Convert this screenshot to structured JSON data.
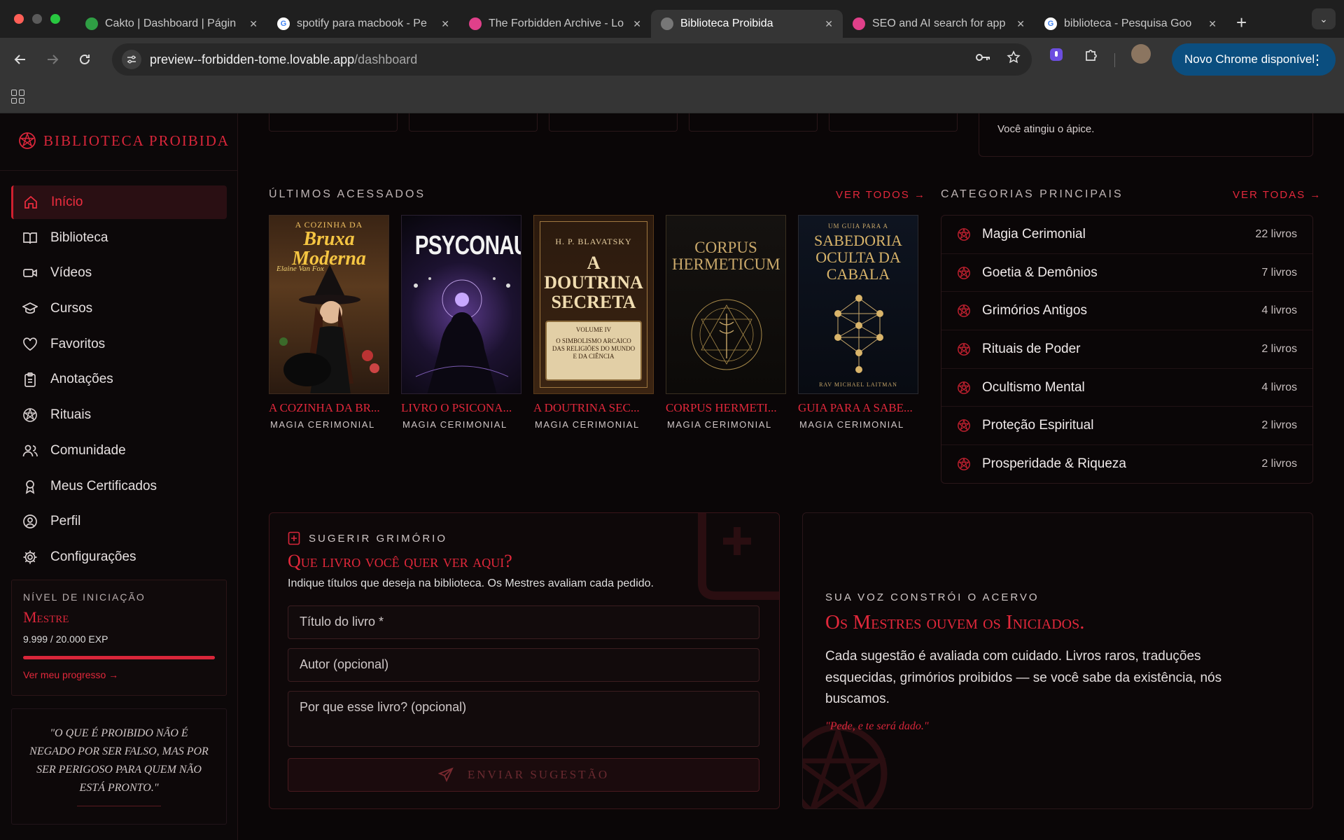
{
  "browser": {
    "tabs": [
      {
        "title": "Cakto | Dashboard | Págin",
        "icon": "cakto-icon",
        "color": "#2f9e44"
      },
      {
        "title": "spotify para macbook - Pe",
        "icon": "google-icon",
        "color": "#ffffff"
      },
      {
        "title": "The Forbidden Archive - Lo",
        "icon": "lovable-icon",
        "color": "#e0408a"
      },
      {
        "title": "Biblioteca Proibida",
        "icon": "globe-icon",
        "color": "#9a9a9a"
      },
      {
        "title": "SEO and AI search for app",
        "icon": "lovable-icon",
        "color": "#e0408a"
      },
      {
        "title": "biblioteca - Pesquisa Goo",
        "icon": "google-icon",
        "color": "#ffffff"
      }
    ],
    "active_tab": 3,
    "url_host": "preview--forbidden-tome.lovable.app",
    "url_path": "/dashboard",
    "update_button": "Novo Chrome disponível"
  },
  "sidebar": {
    "brand": "BIBLIOTECA PROIBIDA",
    "items": [
      {
        "label": "Início",
        "icon": "home-icon",
        "active": true
      },
      {
        "label": "Biblioteca",
        "icon": "book-open-icon"
      },
      {
        "label": "Vídeos",
        "icon": "video-icon"
      },
      {
        "label": "Cursos",
        "icon": "graduation-cap-icon"
      },
      {
        "label": "Favoritos",
        "icon": "heart-icon"
      },
      {
        "label": "Anotações",
        "icon": "clipboard-icon"
      },
      {
        "label": "Rituais",
        "icon": "pentagram-icon"
      },
      {
        "label": "Comunidade",
        "icon": "users-icon"
      },
      {
        "label": "Meus Certificados",
        "icon": "award-icon"
      },
      {
        "label": "Perfil",
        "icon": "user-circle-icon"
      },
      {
        "label": "Configurações",
        "icon": "gear-icon"
      }
    ],
    "level": {
      "label": "NÍVEL DE INICIAÇÃO",
      "name": "Mestre",
      "exp": "9.999 / 20.000 EXP",
      "progress": 0.99995,
      "link": "Ver meu progresso →"
    },
    "quote": "\"O que é proibido não é negado por ser falso, mas por ser perigoso para quem não está pronto.\""
  },
  "main": {
    "top_card_text": "Você atingiu o ápice.",
    "recent": {
      "title": "ÚLTIMOS ACESSADOS",
      "see_all": "VER TODOS →",
      "books": [
        {
          "title": "A COZINHA DA BR...",
          "category": "MAGIA CERIMONIAL",
          "cover_top": "A COZINHA DA",
          "cover_main": "Bruxa Moderna",
          "cover_author": "Elaine Van Fox"
        },
        {
          "title": "LIVRO O PSICONA...",
          "category": "MAGIA CERIMONIAL",
          "cover_main": "PSYCONAUTA"
        },
        {
          "title": "A DOUTRINA SEC...",
          "category": "MAGIA CERIMONIAL",
          "cover_author": "H. P. BLAVATSKY",
          "cover_main": "A DOUTRINA SECRETA",
          "cover_volume": "VOLUME IV",
          "cover_sub": "O SIMBOLISMO ARCAICO DAS RELIGIÕES DO MUNDO E DA CIÊNCIA"
        },
        {
          "title": "CORPUS HERMETI...",
          "category": "MAGIA CERIMONIAL",
          "cover_main": "CORPUS HERMETICUM"
        },
        {
          "title": "GUIA PARA A SABE...",
          "category": "MAGIA CERIMONIAL",
          "cover_top": "UM GUIA PARA A",
          "cover_main": "SABEDORIA OCULTA DA CABALA",
          "cover_author": "RAV MICHAEL LAITMAN"
        }
      ]
    },
    "categories": {
      "title": "CATEGORIAS PRINCIPAIS",
      "see_all": "VER TODAS →",
      "items": [
        {
          "name": "Magia Cerimonial",
          "count": "22 livros"
        },
        {
          "name": "Goetia & Demônios",
          "count": "7 livros"
        },
        {
          "name": "Grimórios Antigos",
          "count": "4 livros"
        },
        {
          "name": "Rituais de Poder",
          "count": "2 livros"
        },
        {
          "name": "Ocultismo Mental",
          "count": "4 livros"
        },
        {
          "name": "Proteção Espiritual",
          "count": "2 livros"
        },
        {
          "name": "Prosperidade & Riqueza",
          "count": "2 livros"
        }
      ]
    },
    "suggest": {
      "label": "SUGERIR GRIMÓRIO",
      "heading": "Que livro você quer ver aqui?",
      "description": "Indique títulos que deseja na biblioteca. Os Mestres avaliam cada pedido.",
      "title_placeholder": "Título do livro *",
      "author_placeholder": "Autor (opcional)",
      "reason_placeholder": "Por que esse livro? (opcional)",
      "submit": "ENVIAR SUGESTÃO"
    },
    "voice": {
      "label": "SUA VOZ CONSTRÓI O ACERVO",
      "heading": "Os Mestres ouvem os Iniciados.",
      "text": "Cada sugestão é avaliada com cuidado. Livros raros, traduções esquecidas, grimórios proibidos — se você sabe da existência, nós buscamos.",
      "quote": "\"Pede, e te será dado.\""
    }
  },
  "colors": {
    "accent": "#e2283b",
    "background": "#0a0607",
    "chrome_blue": "#0b4e7f"
  }
}
